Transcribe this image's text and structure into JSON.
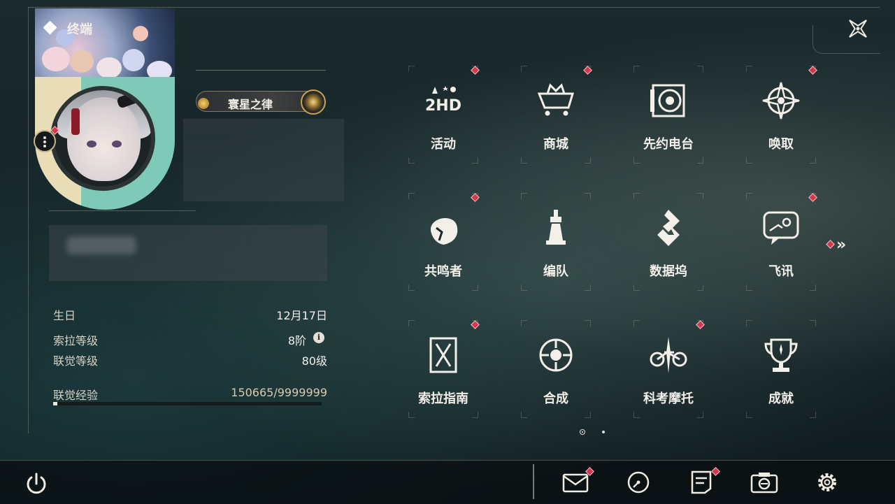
{
  "header": {
    "title": "终端"
  },
  "profile": {
    "title_badge": "寰星之律",
    "birthday_label": "生日",
    "birthday_value": "12月17日",
    "sola_level_label": "索拉等级",
    "sola_level_value": "8阶",
    "union_level_label": "联觉等级",
    "union_level_value": "80级",
    "union_exp_label": "联觉经验",
    "union_exp_value": "150665/9999999",
    "union_exp_progress": 0.015
  },
  "menu": {
    "tiles": [
      {
        "label": "活动",
        "icon": "event-2hd-icon",
        "badge": true
      },
      {
        "label": "商城",
        "icon": "shop-crown-cart-icon",
        "badge": true
      },
      {
        "label": "先约电台",
        "icon": "radio-disc-icon",
        "badge": false
      },
      {
        "label": "唤取",
        "icon": "summon-compass-icon",
        "badge": true
      },
      {
        "label": "共鸣者",
        "icon": "resonator-head-icon",
        "badge": true
      },
      {
        "label": "编队",
        "icon": "team-chess-icon",
        "badge": false
      },
      {
        "label": "数据坞",
        "icon": "data-dock-icon",
        "badge": false
      },
      {
        "label": "飞讯",
        "icon": "message-bubble-icon",
        "badge": true
      },
      {
        "label": "索拉指南",
        "icon": "guide-book-icon",
        "badge": true
      },
      {
        "label": "合成",
        "icon": "synthesis-orb-icon",
        "badge": false
      },
      {
        "label": "科考摩托",
        "icon": "motorbike-icon",
        "badge": true
      },
      {
        "label": "成就",
        "icon": "trophy-icon",
        "badge": false
      }
    ],
    "next_page_arrow": "»",
    "page": 1,
    "page_count": 2
  },
  "info_glyph": "i",
  "colors": {
    "badge_red": "#d6374a",
    "accent_gold": "#c8a25a",
    "text": "#f3f0ea"
  },
  "bottom_bar": {
    "icons": [
      "mail-icon",
      "clock-icon",
      "notes-icon",
      "camera-icon",
      "settings-gear-icon"
    ],
    "power_icon": "power-icon"
  }
}
